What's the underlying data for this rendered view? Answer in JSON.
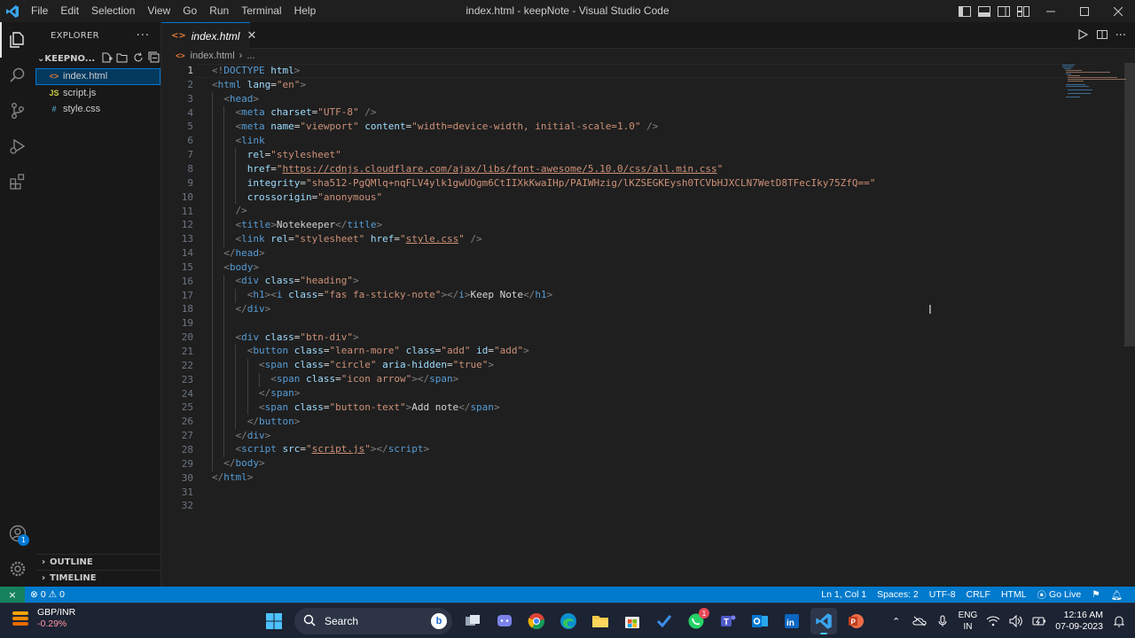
{
  "titlebar": {
    "menu": [
      "File",
      "Edit",
      "Selection",
      "View",
      "Go",
      "Run",
      "Terminal",
      "Help"
    ],
    "window_title": "index.html - keepNote - Visual Studio Code",
    "controls": [
      "minimize",
      "maximize",
      "close"
    ]
  },
  "explorer": {
    "header": "EXPLORER",
    "folder": "KEEPNO...",
    "files": [
      {
        "name": "index.html",
        "icon": "<>",
        "icon_color": "#e37933",
        "selected": true
      },
      {
        "name": "script.js",
        "icon": "JS",
        "icon_color": "#cbcb41",
        "selected": false
      },
      {
        "name": "style.css",
        "icon": "#",
        "icon_color": "#519aba",
        "selected": false
      }
    ],
    "outline": "OUTLINE",
    "timeline": "TIMELINE",
    "accounts_badge": "1"
  },
  "editor": {
    "tab_label": "index.html",
    "breadcrumb_file": "index.html",
    "breadcrumb_rest": "...",
    "current_line": 1,
    "line_count": 32
  },
  "statusbar": {
    "errors": "0",
    "warnings": "0",
    "position": "Ln 1, Col 1",
    "spaces": "Spaces: 2",
    "encoding": "UTF-8",
    "eol": "CRLF",
    "language": "HTML",
    "go_live": "Go Live"
  },
  "taskbar": {
    "weather_title": "GBP/INR",
    "weather_change": "-0.29%",
    "search_placeholder": "Search",
    "teams_badge": "1",
    "lang_top": "ENG",
    "lang_bottom": "IN",
    "time": "12:16 AM",
    "date": "07-09-2023"
  },
  "colors": {
    "statusbar": "#007acc",
    "remote": "#16825d",
    "tag": "#569cd6",
    "attribute": "#9cdcfe",
    "string": "#ce9178"
  }
}
